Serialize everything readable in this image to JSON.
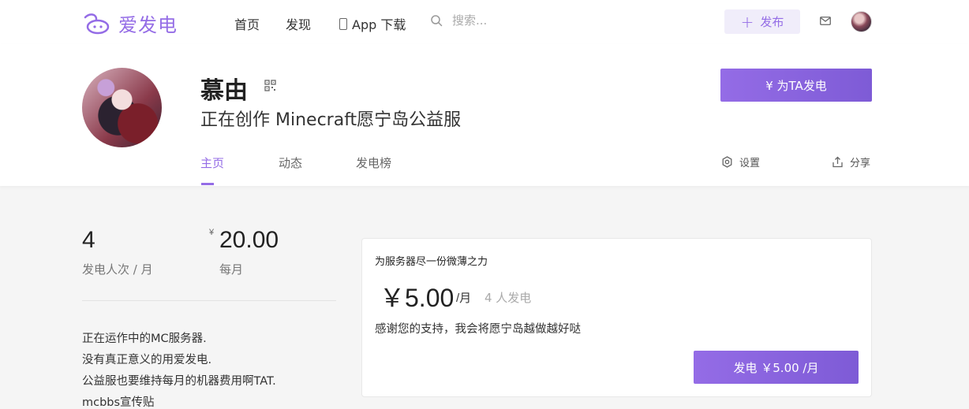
{
  "nav": {
    "logo_text": "爱发电",
    "links": [
      "首页",
      "发现",
      "App 下载"
    ],
    "search_placeholder": "搜索...",
    "publish_label": "发布"
  },
  "profile": {
    "name": "慕由",
    "subtitle": "正在创作 Minecraft愿宁岛公益服",
    "sponsor_button": "¥  为TA发电",
    "tabs": [
      "主页",
      "动态",
      "发电榜"
    ],
    "settings_label": "设置",
    "share_label": "分享"
  },
  "stats": {
    "count": "4",
    "count_label": "发电人次 / 月",
    "currency": "¥",
    "amount": "20.00",
    "amount_label": "每月"
  },
  "description": [
    "正在运作中的MC服务器.",
    "没有真正意义的用爱发电.",
    "公益服也要维持每月的机器费用啊TAT.",
    "mcbbs宣传贴"
  ],
  "plan": {
    "title": "为服务器尽一份微薄之力",
    "price": "￥5.00",
    "unit": "/月",
    "supporters": "4 人发电",
    "desc": "感谢您的支持，我会将愿宁岛越做越好哒",
    "button": "发电 ￥5.00 /月"
  },
  "colors": {
    "accent": "#946ce6",
    "background": "#f5f5f5"
  }
}
